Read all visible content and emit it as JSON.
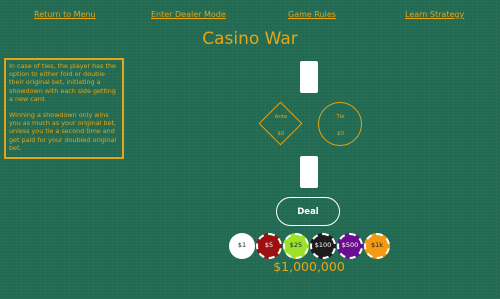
{
  "nav": {
    "return_to_menu": "Return to Menu",
    "dealer_mode": "Enter Dealer Mode",
    "game_rules": "Game Rules",
    "learn_strategy": "Learn Strategy"
  },
  "title": "Casino War",
  "info": {
    "paragraph_1": "In case of ties, the player has the option to either fold or double their original bet, initiating a showdown with each side getting a new card.",
    "paragraph_2": "Winning a showdown only wins you as much as your original bet, unless you tie a second time and get paid for your doubled original bet."
  },
  "bets": {
    "ante_label": "Ante",
    "ante_value": "$0",
    "tie_label": "Tie",
    "tie_value": "$0"
  },
  "deal_label": "Deal",
  "chips": [
    {
      "label": "$1",
      "color": "#ffffff",
      "text_color": "#222222"
    },
    {
      "label": "$5",
      "color": "#9b1111",
      "text_color": "#ffffff"
    },
    {
      "label": "$25",
      "color": "#9be22a",
      "text_color": "#222222"
    },
    {
      "label": "$100",
      "color": "#1c1c1c",
      "text_color": "#ffffff"
    },
    {
      "label": "$500",
      "color": "#6a0d91",
      "text_color": "#ffffff"
    },
    {
      "label": "$1k",
      "color": "#f39a12",
      "text_color": "#222222"
    }
  ],
  "bankroll": "$1,000,000",
  "colors": {
    "felt": "#226b52",
    "accent": "#e6a417"
  }
}
